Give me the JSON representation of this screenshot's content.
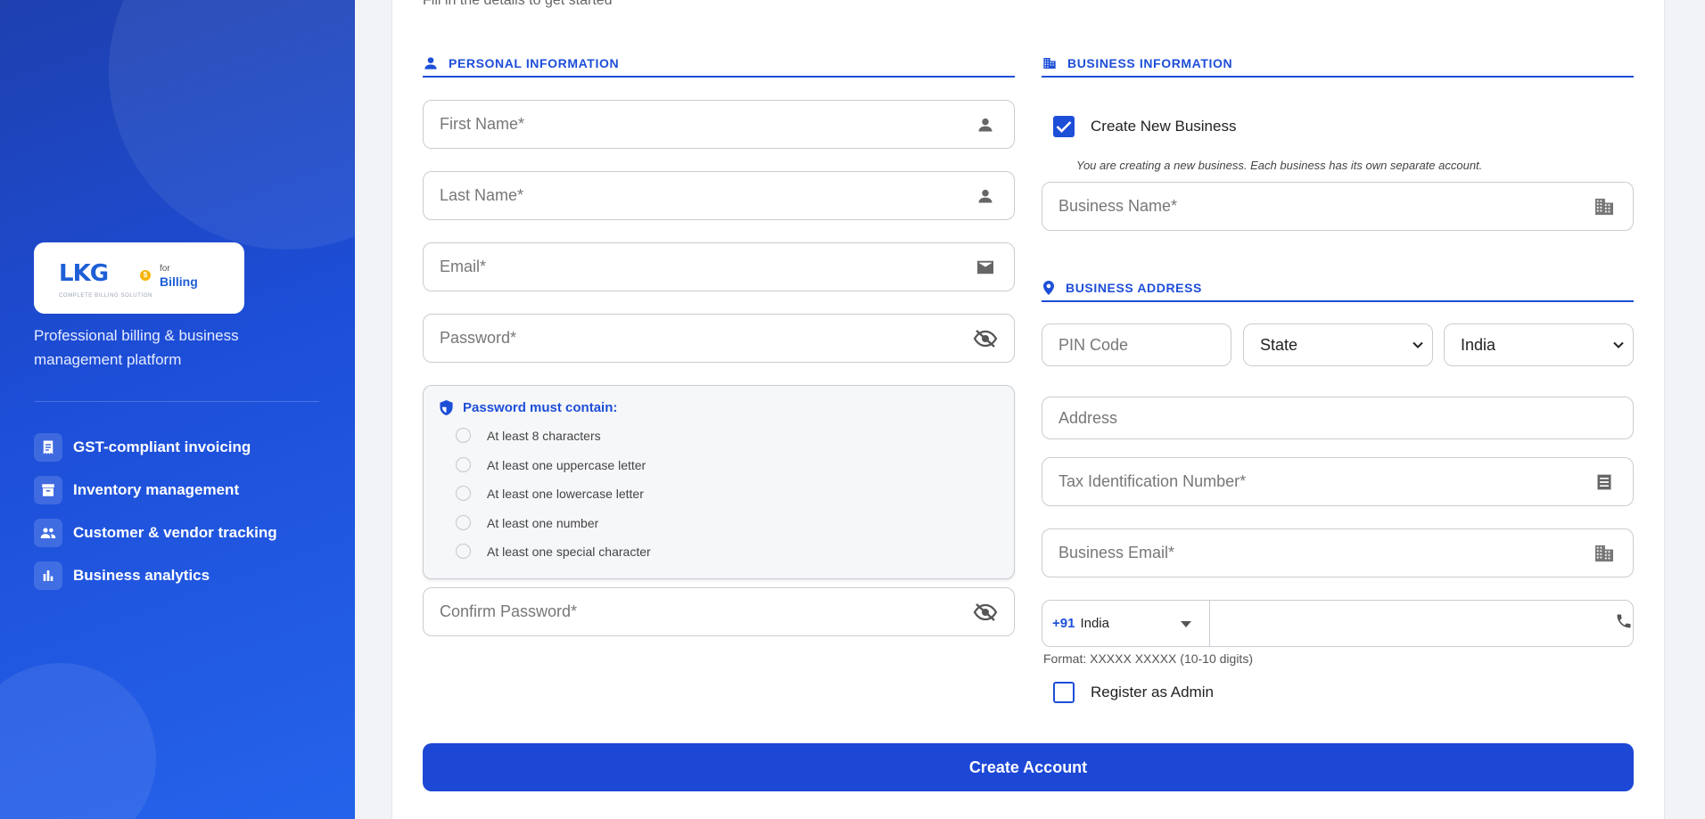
{
  "brand": {
    "logo_text": "LKG",
    "logo_subtext": "COMPLETE BILLING SOLUTION",
    "logo_for": "for",
    "logo_billing": "Billing",
    "tagline": "Professional billing & business management platform"
  },
  "features": [
    {
      "label": "GST-compliant invoicing",
      "icon": "receipt-icon"
    },
    {
      "label": "Inventory management",
      "icon": "archive-icon"
    },
    {
      "label": "Customer & vendor tracking",
      "icon": "people-icon"
    },
    {
      "label": "Business analytics",
      "icon": "bar-chart-icon"
    }
  ],
  "form": {
    "subtitle": "Fill in the details to get started",
    "personal_heading": "PERSONAL INFORMATION",
    "business_heading": "BUSINESS INFORMATION",
    "address_heading": "BUSINESS ADDRESS",
    "first_name_placeholder": "First Name*",
    "last_name_placeholder": "Last Name*",
    "email_placeholder": "Email*",
    "password_placeholder": "Password*",
    "confirm_password_placeholder": "Confirm Password*",
    "password_rules_title": "Password must contain:",
    "password_rules": [
      "At least 8 characters",
      "At least one uppercase letter",
      "At least one lowercase letter",
      "At least one number",
      "At least one special character"
    ],
    "create_business_label": "Create New Business",
    "create_business_checked": true,
    "create_business_note": "You are creating a new business. Each business has its own separate account.",
    "business_name_placeholder": "Business Name*",
    "pin_placeholder": "PIN Code",
    "state_selected": "State",
    "country_selected": "India",
    "address_placeholder": "Address",
    "tax_id_placeholder": "Tax Identification Number*",
    "business_email_placeholder": "Business Email*",
    "phone_dial_code": "+91",
    "phone_country": "India",
    "phone_format_hint": "Format: XXXXX XXXXX (10-10 digits)",
    "register_admin_label": "Register as Admin",
    "register_admin_checked": false,
    "submit_label": "Create Account"
  },
  "colors": {
    "accent": "#1d4ed8",
    "panel_gradient_start": "#1e40af",
    "panel_gradient_end": "#2563eb",
    "button": "#1d48d6",
    "coin": "#f5b50a"
  }
}
